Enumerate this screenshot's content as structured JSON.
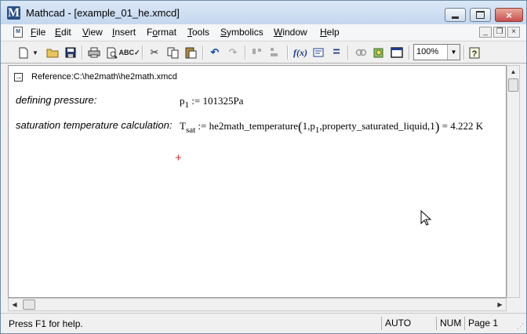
{
  "window": {
    "title": "Mathcad - [example_01_he.xmcd]",
    "app_icon_letter": "M",
    "controls": {
      "minimize": "minimize",
      "maximize": "maximize",
      "close": "×"
    }
  },
  "menu": {
    "items": [
      {
        "label": "File",
        "accel": "F",
        "rest": "ile"
      },
      {
        "label": "Edit",
        "accel": "E",
        "rest": "dit"
      },
      {
        "label": "View",
        "accel": "V",
        "rest": "iew"
      },
      {
        "label": "Insert",
        "accel": "I",
        "rest": "nsert"
      },
      {
        "label": "Format",
        "accel": "o",
        "pre": "F",
        "rest": "rmat"
      },
      {
        "label": "Tools",
        "accel": "T",
        "rest": "ools"
      },
      {
        "label": "Symbolics",
        "accel": "S",
        "rest": "ymbolics"
      },
      {
        "label": "Window",
        "accel": "W",
        "rest": "indow"
      },
      {
        "label": "Help",
        "accel": "H",
        "rest": "elp"
      }
    ],
    "mdi_controls": [
      "_",
      "❐",
      "×"
    ]
  },
  "toolbar": {
    "zoom_value": "100%",
    "icons": [
      "new-document-icon",
      "new-dropdown-icon",
      "open-folder-icon",
      "save-icon",
      "print-icon",
      "print-preview-icon",
      "spell-check-icon",
      "cut-icon",
      "copy-icon",
      "paste-icon",
      "undo-icon",
      "redo-icon",
      "align-across-icon",
      "align-down-icon",
      "insert-function-icon",
      "insert-unit-icon",
      "calculate-icon",
      "insert-hyperlink-icon",
      "insert-component-icon",
      "resource-center-icon",
      "zoom-dropdown",
      "help-icon"
    ]
  },
  "document": {
    "reference": "Reference:C:\\he2math\\he2math.xmcd",
    "regions": [
      {
        "label": "defining pressure:",
        "math": {
          "var": "p",
          "sub": "1",
          "assign": ":=",
          "value": "101325Pa"
        }
      },
      {
        "label": "saturation temperature calculation:",
        "math": {
          "var": "T",
          "sub": "sat",
          "assign": ":=",
          "func": "he2math_temperature",
          "arg1": "1,",
          "arg2_var": "p",
          "arg2_sub": "1",
          "arg3": ",property_saturated_liquid",
          "arg4": ",1",
          "equals": "=",
          "result": "4.222 K"
        }
      }
    ],
    "insertion_cursor": "+"
  },
  "status": {
    "help_text": "Press F1 for help.",
    "mode": "AUTO",
    "numlock": "NUM",
    "page": "Page 1"
  }
}
